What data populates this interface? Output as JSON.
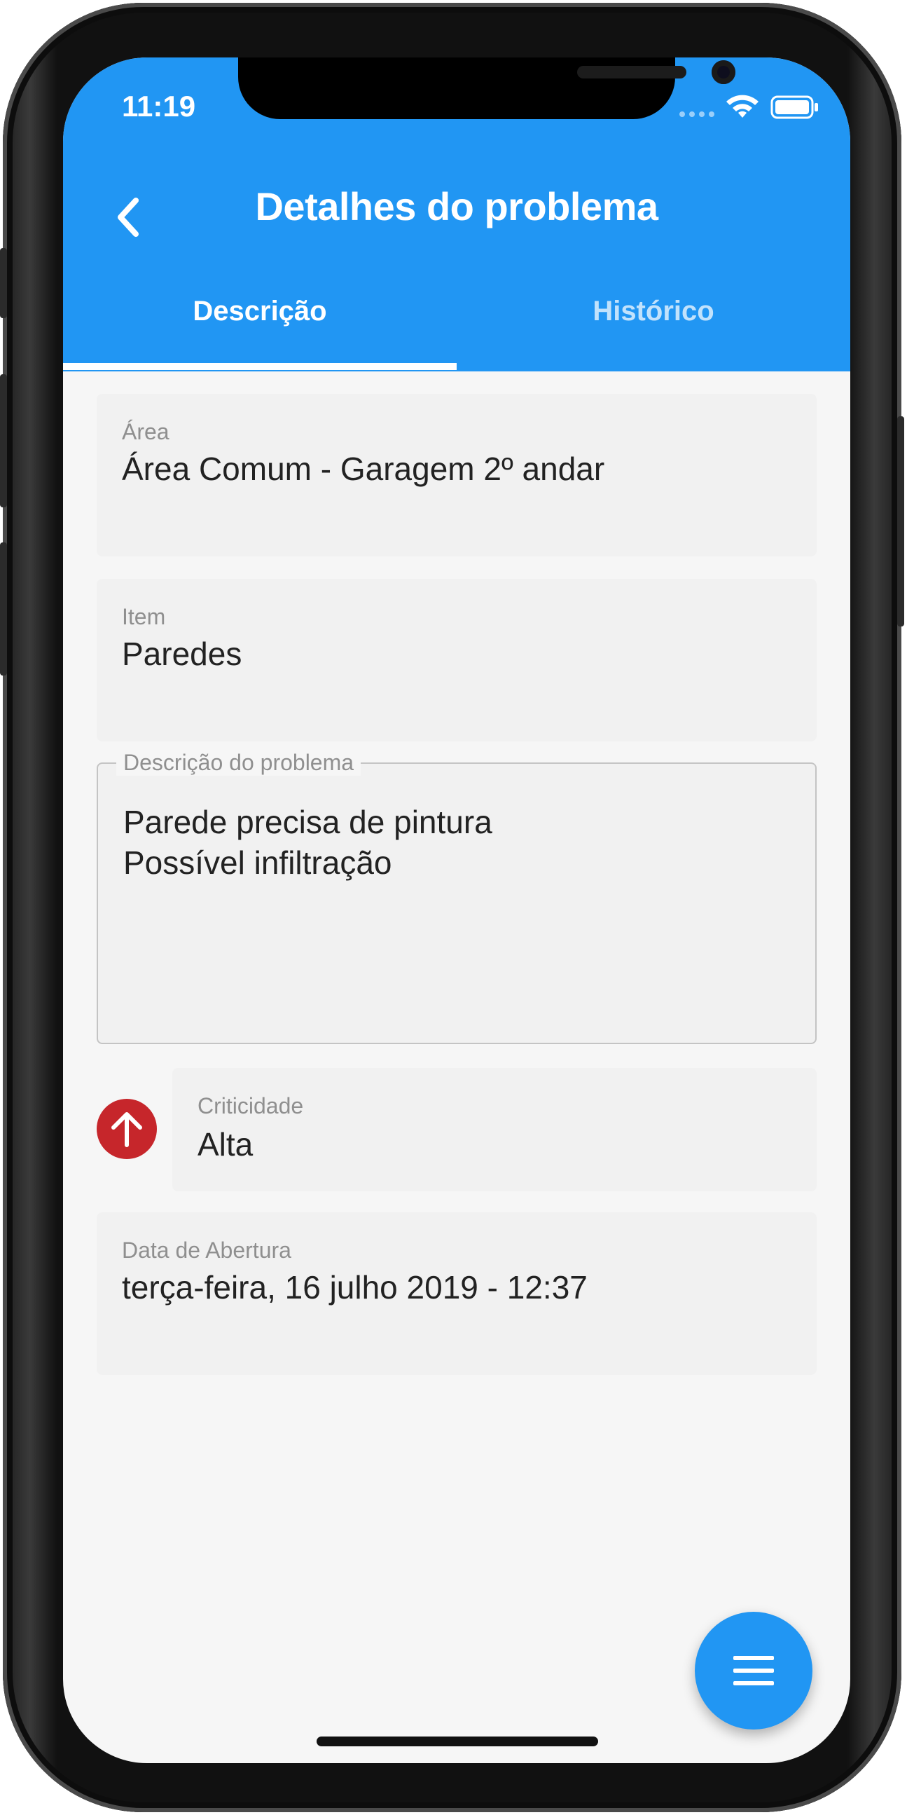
{
  "status_bar": {
    "time": "11:19"
  },
  "app_bar": {
    "title": "Detalhes do problema"
  },
  "tabs": [
    {
      "label": "Descrição",
      "active": true
    },
    {
      "label": "Histórico",
      "active": false
    }
  ],
  "fields": {
    "area": {
      "label": "Área",
      "value": "Área Comum - Garagem 2º andar"
    },
    "item": {
      "label": "Item",
      "value": "Paredes"
    },
    "description": {
      "label": "Descrição do problema",
      "value": "Parede precisa de pintura\nPossível infiltração"
    },
    "criticality": {
      "label": "Criticidade",
      "value": "Alta",
      "icon": "arrow-up-icon",
      "color": "#c6262b"
    },
    "opening_date": {
      "label": "Data de Abertura",
      "value": "terça-feira, 16 julho 2019 - 12:37"
    }
  },
  "fab": {
    "icon": "menu-icon"
  },
  "colors": {
    "primary": "#2196f3",
    "critical": "#c6262b",
    "background": "#f6f6f6"
  }
}
